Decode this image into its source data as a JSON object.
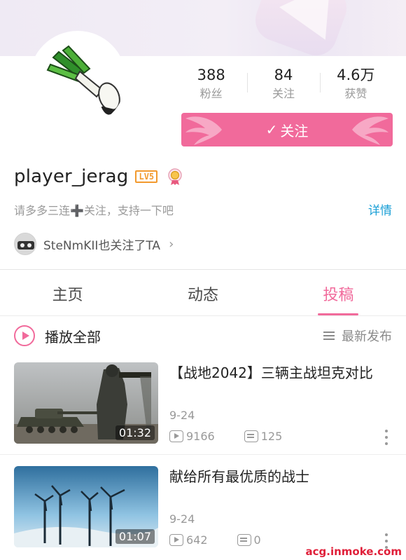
{
  "profile": {
    "username": "player_jerag",
    "level": "LV5",
    "sign": "请多多三连➕关注，支持一下吧",
    "detail_label": "详情",
    "also_follow": "SteNmKII也关注了TA",
    "chevron": "›"
  },
  "stats": [
    {
      "value": "388",
      "label": "粉丝"
    },
    {
      "value": "84",
      "label": "关注"
    },
    {
      "value": "4.6万",
      "label": "获赞"
    }
  ],
  "follow_button": {
    "check": "✓",
    "label": "关注"
  },
  "tabs": [
    {
      "label": "主页",
      "active": false
    },
    {
      "label": "动态",
      "active": false
    },
    {
      "label": "投稿",
      "active": true
    }
  ],
  "list_header": {
    "play_all": "播放全部",
    "sort": "最新发布"
  },
  "videos": [
    {
      "title": "【战地2042】三辆主战坦克对比",
      "date": "9-24",
      "plays": "9166",
      "danmaku": "125",
      "duration": "01:32"
    },
    {
      "title": "献给所有最优质的战士",
      "date": "9-24",
      "plays": "642",
      "danmaku": "0",
      "duration": "01:07"
    }
  ],
  "watermark": "acg.inmoke.com",
  "colors": {
    "accent": "#f16a9b",
    "link": "#1a9fd6",
    "level": "#f29a2e",
    "text_muted": "#9a9a9a"
  }
}
